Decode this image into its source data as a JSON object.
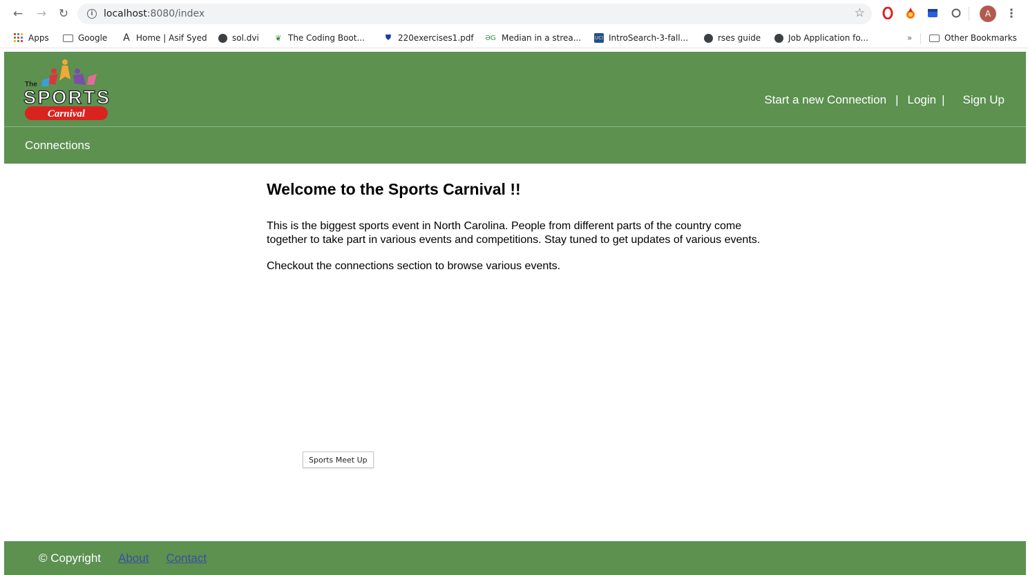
{
  "browser": {
    "url_host": "localhost",
    "url_path": ":8080/index",
    "bookmarks": [
      {
        "label": "Apps"
      },
      {
        "label": "Google"
      },
      {
        "label": "Home | Asif Syed"
      },
      {
        "label": "sol.dvi"
      },
      {
        "label": "The Coding Boot..."
      },
      {
        "label": "220exercises1.pdf"
      },
      {
        "label": "Median in a strea..."
      },
      {
        "label": "IntroSearch-3-fall..."
      },
      {
        "label": "rses guide"
      },
      {
        "label": "Job Application fo..."
      },
      {
        "label": "»"
      },
      {
        "label": "Other Bookmarks"
      }
    ],
    "profile_initial": "A"
  },
  "header": {
    "logo": {
      "top": "The",
      "main": "SPORTS",
      "sub": "Carnival"
    },
    "links": {
      "new_connection": "Start a new Connection",
      "login": "Login",
      "signup": "Sign Up",
      "sep": "|"
    }
  },
  "subnav": {
    "connections": "Connections"
  },
  "main": {
    "title": "Welcome to the Sports Carnival !!",
    "intro": "This is the biggest sports event in North Carolina. People from different parts of the country come together to take part in various events and competitions. Stay tuned to get updates of various events.",
    "cta": "Checkout the connections section to browse various events."
  },
  "tooltip": "Sports Meet Up",
  "footer": {
    "copyright": "© Copyright",
    "about": "About",
    "contact": "Contact"
  },
  "colors": {
    "brand_green": "#5c9150",
    "footer_link": "#3b4fa0"
  }
}
